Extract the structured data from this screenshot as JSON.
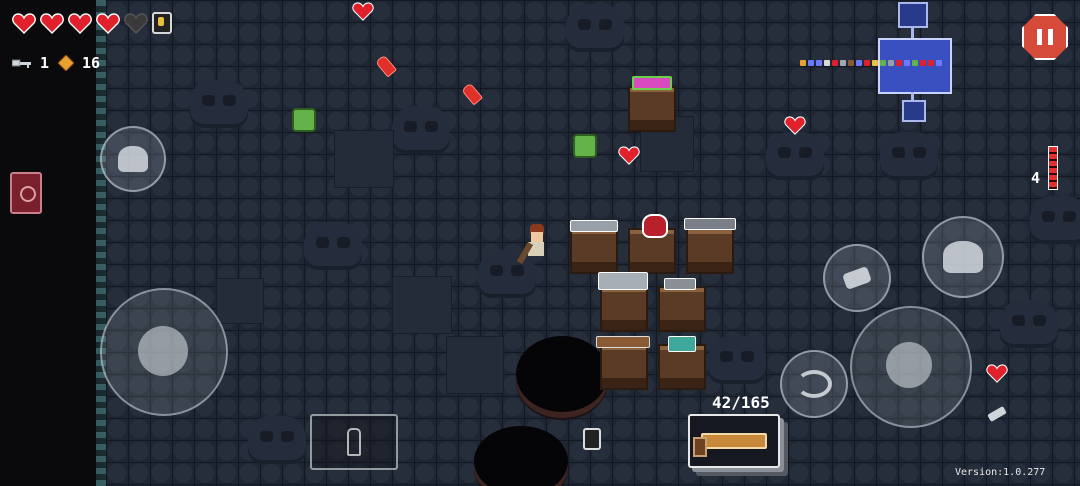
{
  "hud": {
    "hearts": [
      "full",
      "full",
      "full",
      "full",
      "empty"
    ],
    "key_count": "1",
    "shell_count": "16",
    "ammo_count": "42/165",
    "clip_remaining": "4",
    "version": "Version:1.0.277"
  },
  "icons": {
    "key": "key-icon",
    "shell": "shell-currency-icon",
    "armor": "armor-icon",
    "pause": "pause-icon",
    "dodge": "dodge-roll-icon",
    "blank": "blank-icon",
    "swap": "swap-weapon-icon",
    "active_item": "active-item-icon"
  },
  "colors": {
    "heart": "#e0202a",
    "heart_empty": "#3a3a3a",
    "pause": "#d64a3a",
    "minimap": "#3a4fc0",
    "floor": "#1e2533"
  }
}
